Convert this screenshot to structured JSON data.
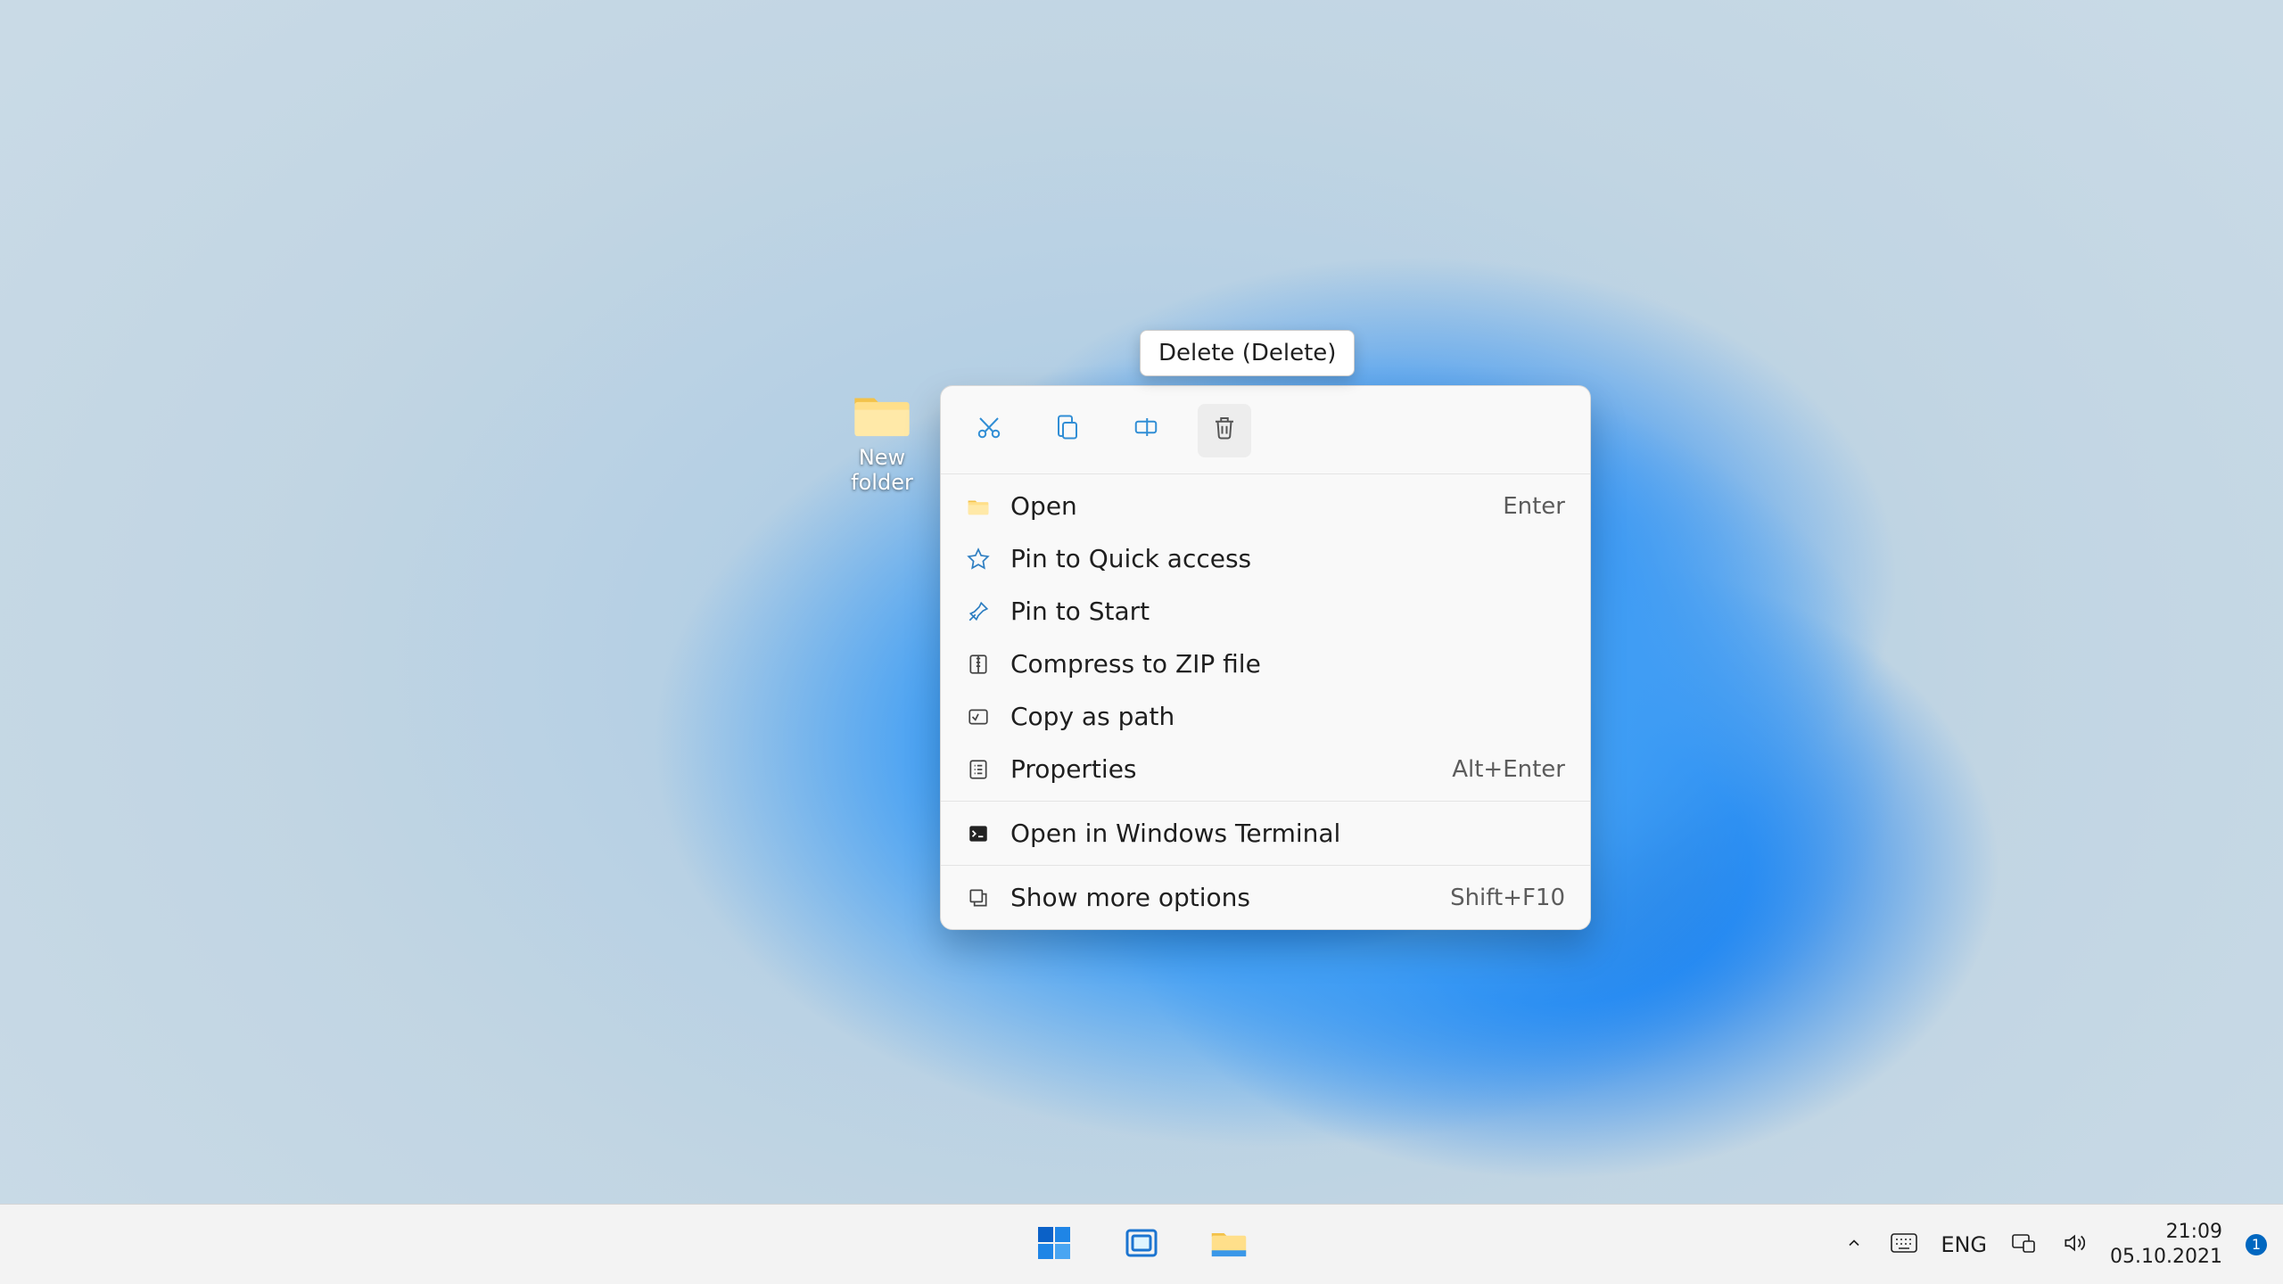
{
  "desktop": {
    "folder_label": "New folder"
  },
  "tooltip": {
    "text": "Delete (Delete)"
  },
  "context_menu": {
    "icon_row": {
      "cut": {
        "name": "cut-icon"
      },
      "copy": {
        "name": "copy-icon"
      },
      "rename": {
        "name": "rename-icon"
      },
      "delete": {
        "name": "delete-icon",
        "hovered": true
      }
    },
    "items": [
      {
        "icon": "folder-icon",
        "label": "Open",
        "shortcut": "Enter"
      },
      {
        "icon": "star-icon",
        "label": "Pin to Quick access",
        "shortcut": ""
      },
      {
        "icon": "pin-icon",
        "label": "Pin to Start",
        "shortcut": ""
      },
      {
        "icon": "zip-icon",
        "label": "Compress to ZIP file",
        "shortcut": ""
      },
      {
        "icon": "copy-path-icon",
        "label": "Copy as path",
        "shortcut": ""
      },
      {
        "icon": "properties-icon",
        "label": "Properties",
        "shortcut": "Alt+Enter"
      }
    ],
    "group2": [
      {
        "icon": "terminal-icon",
        "label": "Open in Windows Terminal",
        "shortcut": ""
      }
    ],
    "group3": [
      {
        "icon": "more-options-icon",
        "label": "Show more options",
        "shortcut": "Shift+F10"
      }
    ]
  },
  "taskbar": {
    "center_icons": [
      "start-icon",
      "task-view-icon",
      "file-explorer-icon"
    ],
    "tray": {
      "overflow": "chevron-up-icon",
      "keyboard": "keyboard-icon",
      "language": "ENG",
      "network": "network-icon",
      "volume": "volume-icon",
      "time": "21:09",
      "date": "05.10.2021",
      "badge": "1"
    }
  }
}
